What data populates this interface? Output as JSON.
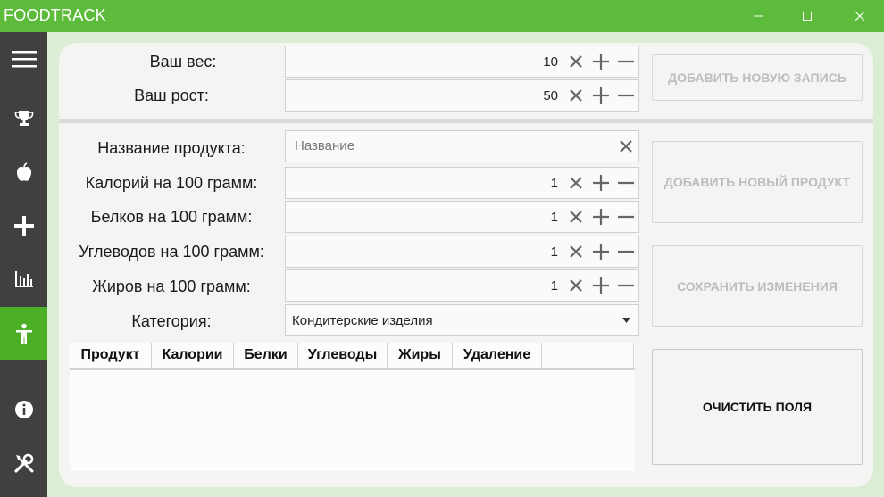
{
  "app": {
    "title": "FOODTRACK"
  },
  "window_controls": {
    "minimize": "—",
    "maximize": "☐",
    "close": "✕"
  },
  "sidebar": {
    "items": [
      {
        "icon": "hamburger-menu-icon",
        "active": false
      },
      {
        "icon": "trophy-icon",
        "active": false
      },
      {
        "icon": "apple-icon",
        "active": false
      },
      {
        "icon": "plus-icon",
        "active": false
      },
      {
        "icon": "bar-chart-icon",
        "active": false
      },
      {
        "icon": "person-icon",
        "active": true
      },
      {
        "icon": "info-icon",
        "active": false
      },
      {
        "icon": "tools-icon",
        "active": false
      }
    ],
    "active_color": "#4caf26"
  },
  "profile": {
    "weight_label": "Ваш вес:",
    "weight_value": "10",
    "height_label": "Ваш рост:",
    "height_value": "50",
    "add_entry_button": "ДОБАВИТЬ НОВУЮ ЗАПИСЬ"
  },
  "product": {
    "name_label": "Название продукта:",
    "name_placeholder": "Название",
    "calories_label": "Калорий на 100 грамм:",
    "calories_value": "1",
    "protein_label": "Белков на 100 грамм:",
    "protein_value": "1",
    "carbs_label": "Углеводов на 100 грамм:",
    "carbs_value": "1",
    "fat_label": "Жиров на 100 грамм:",
    "fat_value": "1",
    "category_label": "Категория:",
    "category_value": "Кондитерские изделия"
  },
  "buttons": {
    "add_product": "ДОБАВИТЬ НОВЫЙ ПРОДУКТ",
    "save_changes": "СОХРАНИТЬ ИЗМЕНЕНИЯ",
    "clear_fields": "ОЧИСТИТЬ ПОЛЯ"
  },
  "table": {
    "columns": [
      "Продукт",
      "Калории",
      "Белки",
      "Углеводы",
      "Жиры",
      "Удаление"
    ]
  },
  "colors": {
    "titlebar": "#5dbb3b",
    "sidebar": "#404040",
    "background": "#dcedd6"
  }
}
